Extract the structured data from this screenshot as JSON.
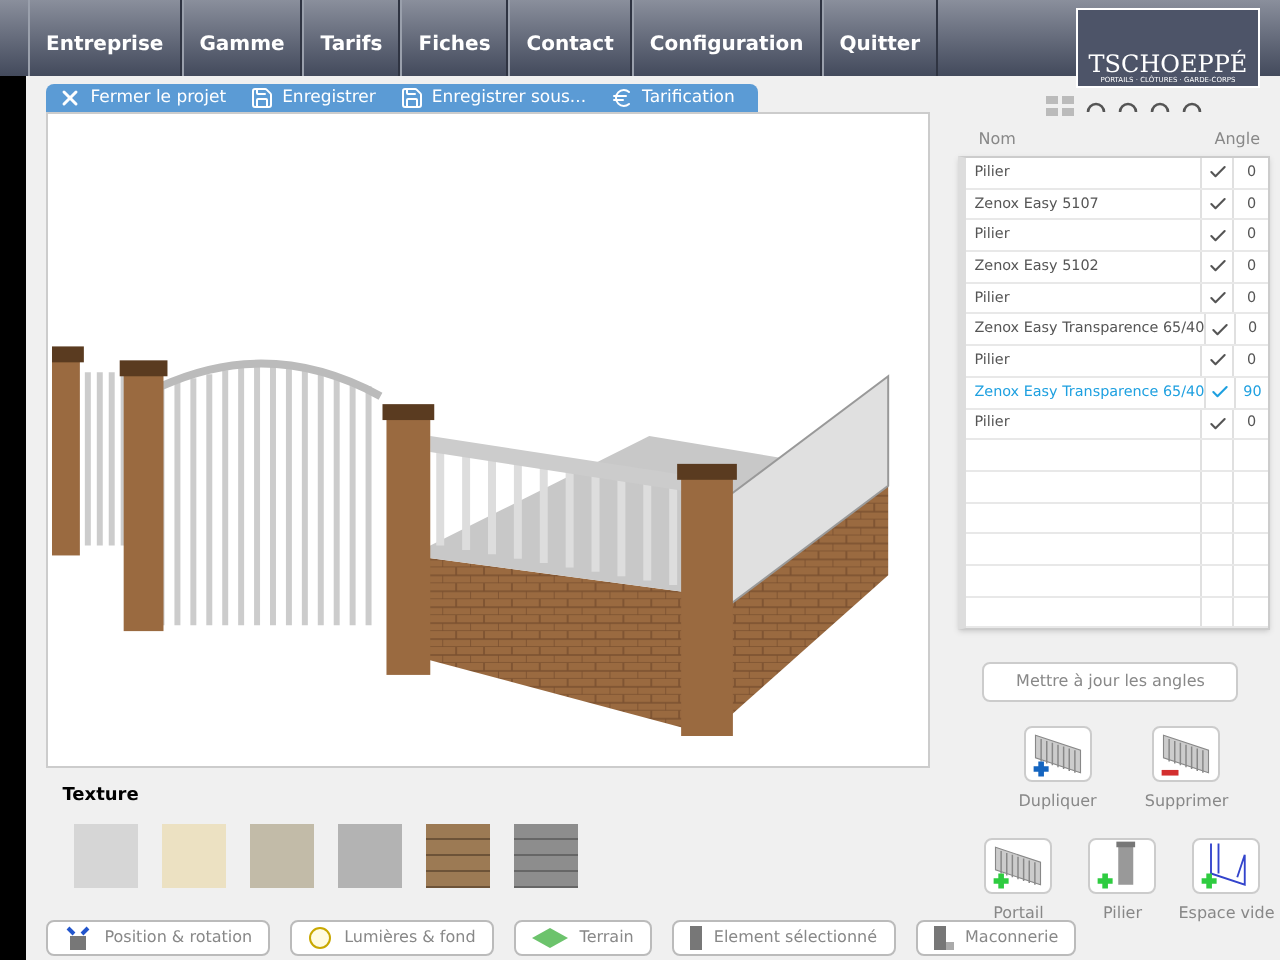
{
  "nav": {
    "items": [
      {
        "label": "Entreprise"
      },
      {
        "label": "Gamme"
      },
      {
        "label": "Tarifs"
      },
      {
        "label": "Fiches"
      },
      {
        "label": "Contact"
      },
      {
        "label": "Configuration"
      },
      {
        "label": "Quitter"
      }
    ]
  },
  "logo": {
    "name": "TSCHOEPPÉ",
    "tagline": "PORTAILS · CLÔTURES · GARDE-CORPS"
  },
  "project_toolbar": [
    {
      "kind": "close",
      "label": "Fermer le projet"
    },
    {
      "kind": "save",
      "label": "Enregistrer"
    },
    {
      "kind": "save",
      "label": "Enregistrer sous..."
    },
    {
      "kind": "price",
      "label": "Tarification"
    }
  ],
  "elements_table": {
    "columns": [
      "Nom",
      "Angle"
    ],
    "rows": [
      {
        "name": "Pilier",
        "checked": true,
        "angle": "0",
        "selected": false
      },
      {
        "name": "Zenox Easy 5107",
        "checked": true,
        "angle": "0",
        "selected": false
      },
      {
        "name": "Pilier",
        "checked": true,
        "angle": "0",
        "selected": false
      },
      {
        "name": "Zenox Easy 5102",
        "checked": true,
        "angle": "0",
        "selected": false
      },
      {
        "name": "Pilier",
        "checked": true,
        "angle": "0",
        "selected": false
      },
      {
        "name": "Zenox Easy Transparence 65/40",
        "checked": true,
        "angle": "0",
        "selected": false
      },
      {
        "name": "Pilier",
        "checked": true,
        "angle": "0",
        "selected": false
      },
      {
        "name": "Zenox Easy Transparence 65/40",
        "checked": true,
        "angle": "90",
        "selected": true
      },
      {
        "name": "Pilier",
        "checked": true,
        "angle": "0",
        "selected": false
      }
    ]
  },
  "update_button": "Mettre à jour les angles",
  "actions": [
    {
      "kind": "duplicate",
      "label": "Dupliquer"
    },
    {
      "kind": "delete",
      "label": "Supprimer"
    }
  ],
  "add_actions": [
    {
      "kind": "gate",
      "label": "Portail"
    },
    {
      "kind": "pillar",
      "label": "Pilier"
    },
    {
      "kind": "gap",
      "label": "Espace vide"
    }
  ],
  "texture": {
    "title": "Texture"
  },
  "bottom_tabs": [
    {
      "kind": "position",
      "label": "Position & rotation"
    },
    {
      "kind": "light",
      "label": "Lumières & fond"
    },
    {
      "kind": "terrain",
      "label": "Terrain"
    },
    {
      "kind": "element",
      "label": "Element sélectionné"
    },
    {
      "kind": "masonry",
      "label": "Maconnerie"
    }
  ]
}
